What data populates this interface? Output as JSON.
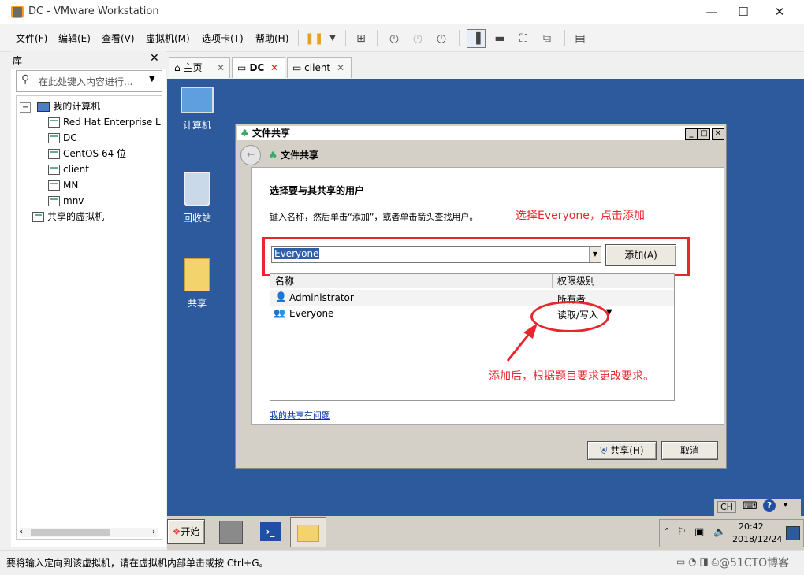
{
  "window": {
    "title": "DC - VMware Workstation"
  },
  "menu": [
    "文件(F)",
    "编辑(E)",
    "查看(V)",
    "虚拟机(M)",
    "选项卡(T)",
    "帮助(H)"
  ],
  "library": {
    "title": "库",
    "search_placeholder": "在此处键入内容进行...",
    "root": "我的计算机",
    "vms": [
      "Red Hat Enterprise L",
      "DC",
      "CentOS 64 位",
      "client",
      "MN",
      "mnv"
    ],
    "shared": "共享的虚拟机"
  },
  "tabs": [
    {
      "label": "主页"
    },
    {
      "label": "DC"
    },
    {
      "label": "client"
    }
  ],
  "desktop_icons": [
    "计算机",
    "回收站",
    "共享"
  ],
  "dialog": {
    "title": "文件共享",
    "nav_title": "文件共享",
    "heading": "选择要与其共享的用户",
    "instruction": "键入名称，然后单击“添加”，或者单击箭头查找用户。",
    "input_value": "Everyone",
    "add_button": "添加(A)",
    "columns": [
      "名称",
      "权限级别"
    ],
    "rows": [
      {
        "name": "Administrator",
        "level": "所有者"
      },
      {
        "name": "Everyone",
        "level": "读取/写入"
      }
    ],
    "link": "我的共享有问题",
    "share_button": "共享(H)",
    "cancel_button": "取消"
  },
  "annotations": {
    "top": "选择Everyone，点击添加",
    "bottom": "添加后，根据题目要求更改要求。"
  },
  "taskbar": {
    "start": "开始",
    "lang": "CH",
    "time": "20:42",
    "date": "2018/12/24"
  },
  "status": {
    "text": "要将输入定向到该虚拟机，请在虚拟机内部单击或按 Ctrl+G。",
    "watermark": "@51CTO博客"
  },
  "colors": {
    "annotation": "#e8262d",
    "desktop": "#2d5a9c"
  }
}
